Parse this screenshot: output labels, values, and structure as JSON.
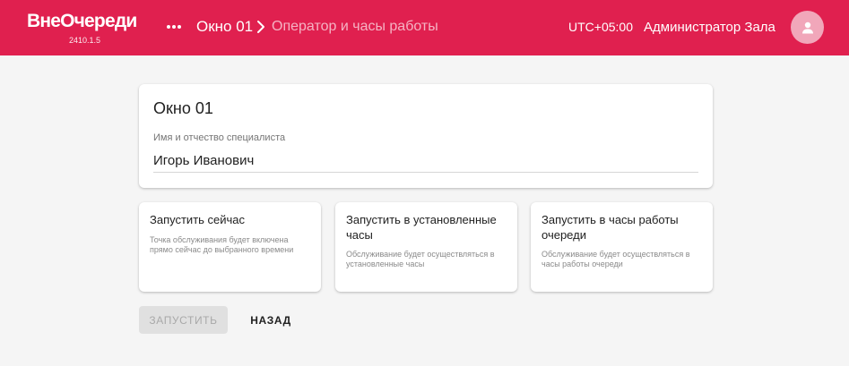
{
  "header": {
    "logo_text": "ВнеОчереди",
    "version": "2410.1.5",
    "menu_icon": "more-horizontal-icon",
    "breadcrumb": {
      "window": "Окно 01",
      "current": "Оператор и часы работы"
    },
    "timezone": "UTC+05:00",
    "user_name": "Администратор Зала",
    "avatar_icon": "person-icon",
    "bg_color": "#e0204f"
  },
  "main_card": {
    "title": "Окно 01",
    "field_label": "Имя и отчество специалиста",
    "field_value": "Игорь Иванович"
  },
  "options": [
    {
      "title": "Запустить сейчас",
      "description": "Точка обслуживания будет включена прямо сейчас до выбранного времени"
    },
    {
      "title": "Запустить в установленные часы",
      "description": "Обслуживание будет осуществляться в установленные часы"
    },
    {
      "title": "Запустить в часы работы очереди",
      "description": "Обслуживание будет осуществляться в часы работы очереди"
    }
  ],
  "actions": {
    "start_label": "ЗАПУСТИТЬ",
    "back_label": "НАЗАД"
  }
}
